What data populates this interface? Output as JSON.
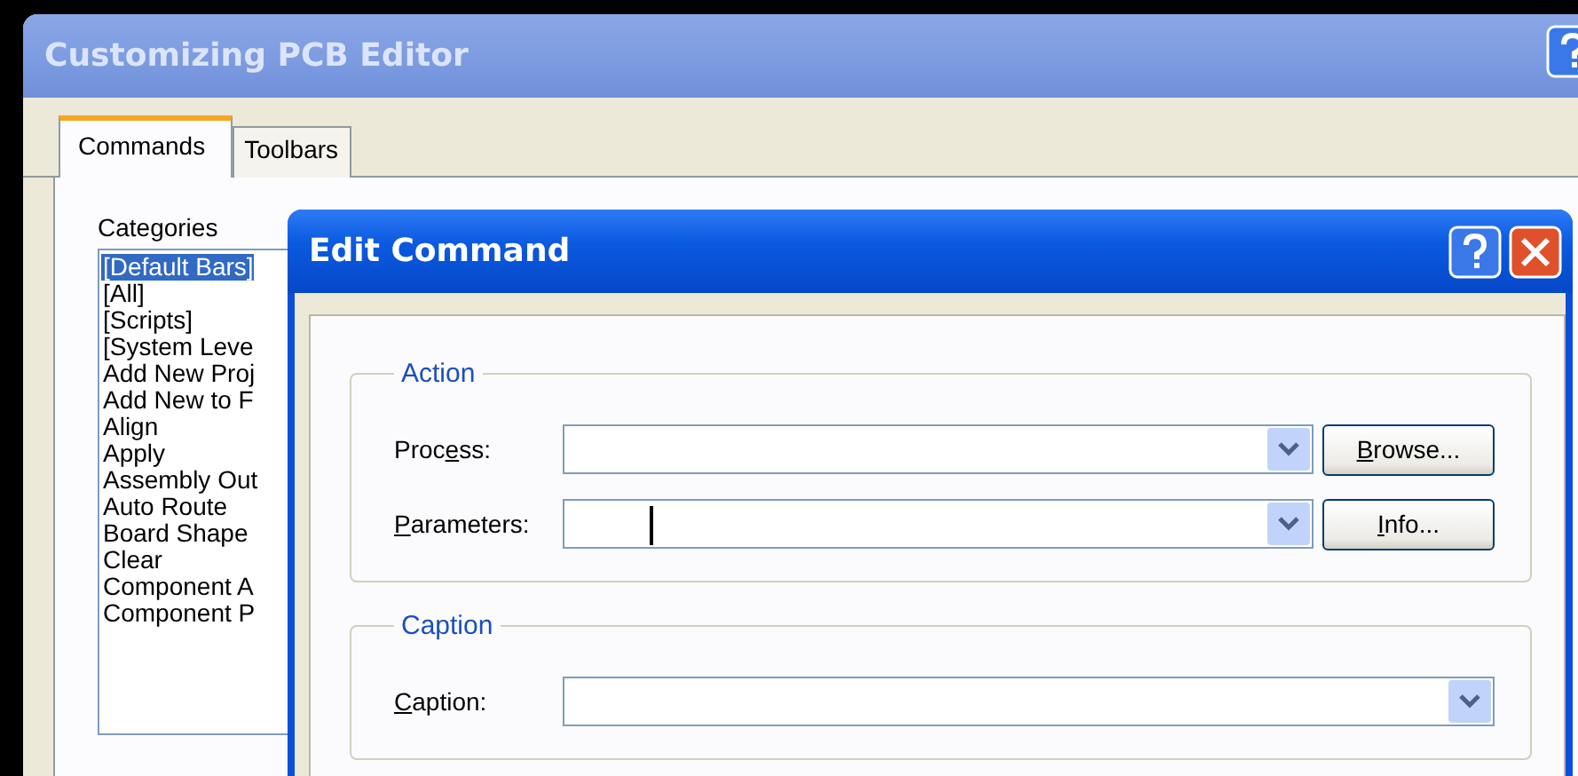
{
  "window": {
    "title": "Customizing PCB Editor"
  },
  "tabs": [
    {
      "label": "Commands",
      "selected": true
    },
    {
      "label": "Toolbars",
      "selected": false
    }
  ],
  "categories": {
    "label": "Categories",
    "items": [
      {
        "label": "[Default Bars]",
        "selected": true
      },
      {
        "label": "[All]",
        "selected": false
      },
      {
        "label": "[Scripts]",
        "selected": false
      },
      {
        "label": "[System Leve",
        "selected": false
      },
      {
        "label": "Add New Proj",
        "selected": false
      },
      {
        "label": "Add New to F",
        "selected": false
      },
      {
        "label": "Align",
        "selected": false
      },
      {
        "label": "Apply",
        "selected": false
      },
      {
        "label": "Assembly Out",
        "selected": false
      },
      {
        "label": "Auto Route",
        "selected": false
      },
      {
        "label": "Board Shape",
        "selected": false
      },
      {
        "label": "Clear",
        "selected": false
      },
      {
        "label": "Component A",
        "selected": false
      },
      {
        "label": "Component P",
        "selected": false
      }
    ]
  },
  "dialog": {
    "title": "Edit Command",
    "groups": [
      {
        "title": "Action",
        "rows": [
          {
            "label": [
              {
                "text": "Proc",
                "underlined": false
              },
              {
                "text": "e",
                "underlined": true
              },
              {
                "text": "ss:",
                "underlined": false
              }
            ],
            "focused": false,
            "button": {
              "label": [
                {
                  "text": "B",
                  "underlined": true
                },
                {
                  "text": "rowse...",
                  "underlined": false
                }
              ]
            }
          },
          {
            "label": [
              {
                "text": "P",
                "underlined": true
              },
              {
                "text": "arameters:",
                "underlined": false
              }
            ],
            "focused": true,
            "button": {
              "label": [
                {
                  "text": "I",
                  "underlined": true
                },
                {
                  "text": "nfo...",
                  "underlined": false
                }
              ]
            }
          }
        ]
      },
      {
        "title": "Caption",
        "rows": [
          {
            "label": [
              {
                "text": "C",
                "underlined": true
              },
              {
                "text": "aption:",
                "underlined": false
              }
            ],
            "focused": false
          }
        ]
      }
    ]
  }
}
